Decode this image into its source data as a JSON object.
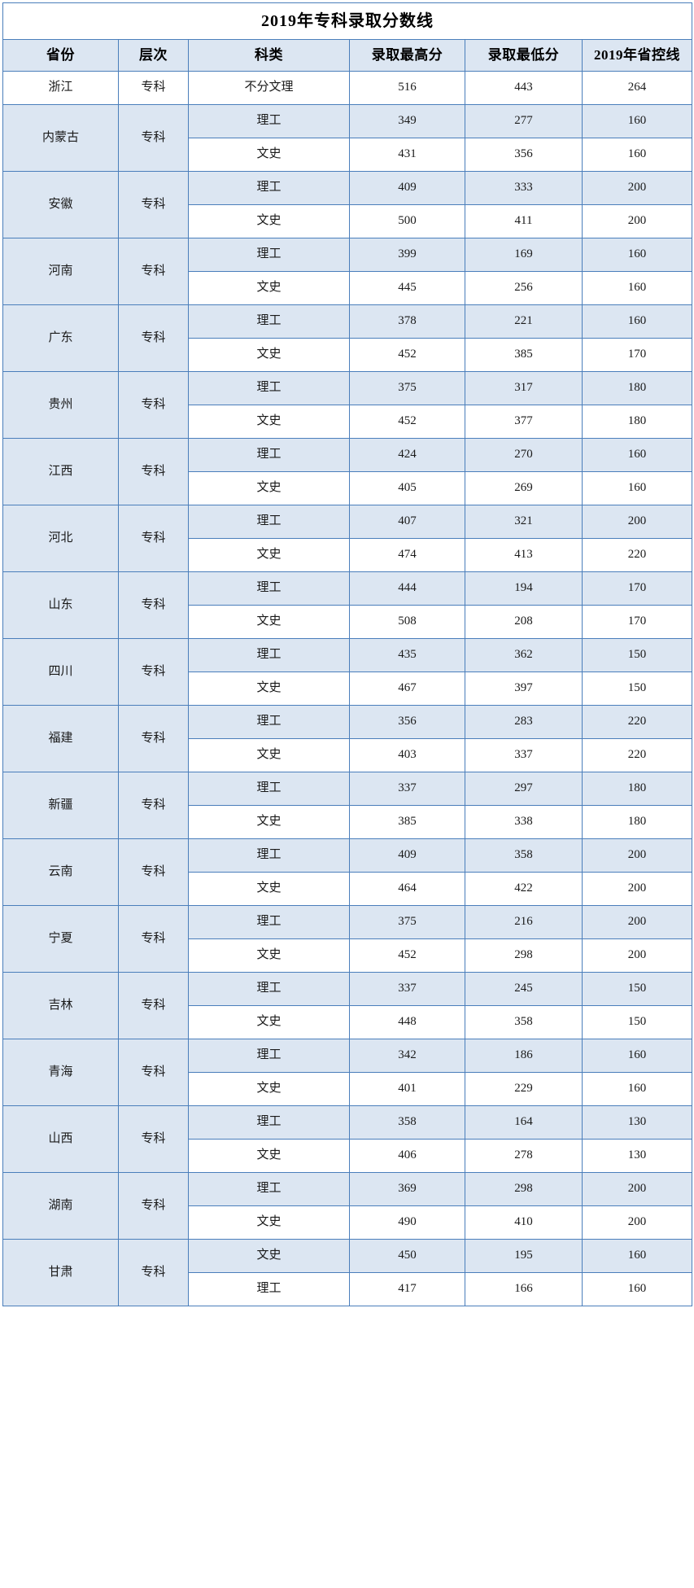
{
  "title": "2019年专科录取分数线",
  "colors": {
    "border": "#4a7ebb",
    "shade": "#dce6f2",
    "background": "#ffffff",
    "text": "#1a1a1a"
  },
  "columns": [
    {
      "key": "province",
      "label": "省份"
    },
    {
      "key": "level",
      "label": "层次"
    },
    {
      "key": "category",
      "label": "科类"
    },
    {
      "key": "highest",
      "label": "录取最高分"
    },
    {
      "key": "lowest",
      "label": "录取最低分"
    },
    {
      "key": "control_line",
      "label": "2019年省控线"
    }
  ],
  "chart_data": {
    "type": "table",
    "title": "2019年专科录取分数线",
    "columns": [
      "省份",
      "层次",
      "科类",
      "录取最高分",
      "录取最低分",
      "2019年省控线"
    ],
    "rows": [
      [
        "浙江",
        "专科",
        "不分文理",
        516,
        443,
        264
      ],
      [
        "内蒙古",
        "专科",
        "理工",
        349,
        277,
        160
      ],
      [
        "内蒙古",
        "专科",
        "文史",
        431,
        356,
        160
      ],
      [
        "安徽",
        "专科",
        "理工",
        409,
        333,
        200
      ],
      [
        "安徽",
        "专科",
        "文史",
        500,
        411,
        200
      ],
      [
        "河南",
        "专科",
        "理工",
        399,
        169,
        160
      ],
      [
        "河南",
        "专科",
        "文史",
        445,
        256,
        160
      ],
      [
        "广东",
        "专科",
        "理工",
        378,
        221,
        160
      ],
      [
        "广东",
        "专科",
        "文史",
        452,
        385,
        170
      ],
      [
        "贵州",
        "专科",
        "理工",
        375,
        317,
        180
      ],
      [
        "贵州",
        "专科",
        "文史",
        452,
        377,
        180
      ],
      [
        "江西",
        "专科",
        "理工",
        424,
        270,
        160
      ],
      [
        "江西",
        "专科",
        "文史",
        405,
        269,
        160
      ],
      [
        "河北",
        "专科",
        "理工",
        407,
        321,
        200
      ],
      [
        "河北",
        "专科",
        "文史",
        474,
        413,
        220
      ],
      [
        "山东",
        "专科",
        "理工",
        444,
        194,
        170
      ],
      [
        "山东",
        "专科",
        "文史",
        508,
        208,
        170
      ],
      [
        "四川",
        "专科",
        "理工",
        435,
        362,
        150
      ],
      [
        "四川",
        "专科",
        "文史",
        467,
        397,
        150
      ],
      [
        "福建",
        "专科",
        "理工",
        356,
        283,
        220
      ],
      [
        "福建",
        "专科",
        "文史",
        403,
        337,
        220
      ],
      [
        "新疆",
        "专科",
        "理工",
        337,
        297,
        180
      ],
      [
        "新疆",
        "专科",
        "文史",
        385,
        338,
        180
      ],
      [
        "云南",
        "专科",
        "理工",
        409,
        358,
        200
      ],
      [
        "云南",
        "专科",
        "文史",
        464,
        422,
        200
      ],
      [
        "宁夏",
        "专科",
        "理工",
        375,
        216,
        200
      ],
      [
        "宁夏",
        "专科",
        "文史",
        452,
        298,
        200
      ],
      [
        "吉林",
        "专科",
        "理工",
        337,
        245,
        150
      ],
      [
        "吉林",
        "专科",
        "文史",
        448,
        358,
        150
      ],
      [
        "青海",
        "专科",
        "理工",
        342,
        186,
        160
      ],
      [
        "青海",
        "专科",
        "文史",
        401,
        229,
        160
      ],
      [
        "山西",
        "专科",
        "理工",
        358,
        164,
        130
      ],
      [
        "山西",
        "专科",
        "文史",
        406,
        278,
        130
      ],
      [
        "湖南",
        "专科",
        "理工",
        369,
        298,
        200
      ],
      [
        "湖南",
        "专科",
        "文史",
        490,
        410,
        200
      ],
      [
        "甘肃",
        "专科",
        "文史",
        450,
        195,
        160
      ],
      [
        "甘肃",
        "专科",
        "理工",
        417,
        166,
        160
      ]
    ]
  },
  "groups": [
    {
      "province": "浙江",
      "level": "专科",
      "shaded": false,
      "entries": [
        {
          "category": "不分文理",
          "highest": "516",
          "lowest": "443",
          "control_line": "264",
          "shaded": false
        }
      ]
    },
    {
      "province": "内蒙古",
      "level": "专科",
      "shaded": true,
      "entries": [
        {
          "category": "理工",
          "highest": "349",
          "lowest": "277",
          "control_line": "160",
          "shaded": true
        },
        {
          "category": "文史",
          "highest": "431",
          "lowest": "356",
          "control_line": "160",
          "shaded": false
        }
      ]
    },
    {
      "province": "安徽",
      "level": "专科",
      "shaded": true,
      "entries": [
        {
          "category": "理工",
          "highest": "409",
          "lowest": "333",
          "control_line": "200",
          "shaded": true
        },
        {
          "category": "文史",
          "highest": "500",
          "lowest": "411",
          "control_line": "200",
          "shaded": false
        }
      ]
    },
    {
      "province": "河南",
      "level": "专科",
      "shaded": true,
      "entries": [
        {
          "category": "理工",
          "highest": "399",
          "lowest": "169",
          "control_line": "160",
          "shaded": true
        },
        {
          "category": "文史",
          "highest": "445",
          "lowest": "256",
          "control_line": "160",
          "shaded": false
        }
      ]
    },
    {
      "province": "广东",
      "level": "专科",
      "shaded": true,
      "entries": [
        {
          "category": "理工",
          "highest": "378",
          "lowest": "221",
          "control_line": "160",
          "shaded": true
        },
        {
          "category": "文史",
          "highest": "452",
          "lowest": "385",
          "control_line": "170",
          "shaded": false
        }
      ]
    },
    {
      "province": "贵州",
      "level": "专科",
      "shaded": true,
      "entries": [
        {
          "category": "理工",
          "highest": "375",
          "lowest": "317",
          "control_line": "180",
          "shaded": true
        },
        {
          "category": "文史",
          "highest": "452",
          "lowest": "377",
          "control_line": "180",
          "shaded": false
        }
      ]
    },
    {
      "province": "江西",
      "level": "专科",
      "shaded": true,
      "entries": [
        {
          "category": "理工",
          "highest": "424",
          "lowest": "270",
          "control_line": "160",
          "shaded": true
        },
        {
          "category": "文史",
          "highest": "405",
          "lowest": "269",
          "control_line": "160",
          "shaded": false
        }
      ]
    },
    {
      "province": "河北",
      "level": "专科",
      "shaded": true,
      "entries": [
        {
          "category": "理工",
          "highest": "407",
          "lowest": "321",
          "control_line": "200",
          "shaded": true
        },
        {
          "category": "文史",
          "highest": "474",
          "lowest": "413",
          "control_line": "220",
          "shaded": false
        }
      ]
    },
    {
      "province": "山东",
      "level": "专科",
      "shaded": true,
      "entries": [
        {
          "category": "理工",
          "highest": "444",
          "lowest": "194",
          "control_line": "170",
          "shaded": true
        },
        {
          "category": "文史",
          "highest": "508",
          "lowest": "208",
          "control_line": "170",
          "shaded": false
        }
      ]
    },
    {
      "province": "四川",
      "level": "专科",
      "shaded": true,
      "entries": [
        {
          "category": "理工",
          "highest": "435",
          "lowest": "362",
          "control_line": "150",
          "shaded": true
        },
        {
          "category": "文史",
          "highest": "467",
          "lowest": "397",
          "control_line": "150",
          "shaded": false
        }
      ]
    },
    {
      "province": "福建",
      "level": "专科",
      "shaded": true,
      "entries": [
        {
          "category": "理工",
          "highest": "356",
          "lowest": "283",
          "control_line": "220",
          "shaded": true
        },
        {
          "category": "文史",
          "highest": "403",
          "lowest": "337",
          "control_line": "220",
          "shaded": false
        }
      ]
    },
    {
      "province": "新疆",
      "level": "专科",
      "shaded": true,
      "entries": [
        {
          "category": "理工",
          "highest": "337",
          "lowest": "297",
          "control_line": "180",
          "shaded": true
        },
        {
          "category": "文史",
          "highest": "385",
          "lowest": "338",
          "control_line": "180",
          "shaded": false
        }
      ]
    },
    {
      "province": "云南",
      "level": "专科",
      "shaded": true,
      "entries": [
        {
          "category": "理工",
          "highest": "409",
          "lowest": "358",
          "control_line": "200",
          "shaded": true
        },
        {
          "category": "文史",
          "highest": "464",
          "lowest": "422",
          "control_line": "200",
          "shaded": false
        }
      ]
    },
    {
      "province": "宁夏",
      "level": "专科",
      "shaded": true,
      "entries": [
        {
          "category": "理工",
          "highest": "375",
          "lowest": "216",
          "control_line": "200",
          "shaded": true
        },
        {
          "category": "文史",
          "highest": "452",
          "lowest": "298",
          "control_line": "200",
          "shaded": false
        }
      ]
    },
    {
      "province": "吉林",
      "level": "专科",
      "shaded": true,
      "entries": [
        {
          "category": "理工",
          "highest": "337",
          "lowest": "245",
          "control_line": "150",
          "shaded": true
        },
        {
          "category": "文史",
          "highest": "448",
          "lowest": "358",
          "control_line": "150",
          "shaded": false
        }
      ]
    },
    {
      "province": "青海",
      "level": "专科",
      "shaded": true,
      "entries": [
        {
          "category": "理工",
          "highest": "342",
          "lowest": "186",
          "control_line": "160",
          "shaded": true
        },
        {
          "category": "文史",
          "highest": "401",
          "lowest": "229",
          "control_line": "160",
          "shaded": false
        }
      ]
    },
    {
      "province": "山西",
      "level": "专科",
      "shaded": true,
      "entries": [
        {
          "category": "理工",
          "highest": "358",
          "lowest": "164",
          "control_line": "130",
          "shaded": true
        },
        {
          "category": "文史",
          "highest": "406",
          "lowest": "278",
          "control_line": "130",
          "shaded": false
        }
      ]
    },
    {
      "province": "湖南",
      "level": "专科",
      "shaded": true,
      "entries": [
        {
          "category": "理工",
          "highest": "369",
          "lowest": "298",
          "control_line": "200",
          "shaded": true
        },
        {
          "category": "文史",
          "highest": "490",
          "lowest": "410",
          "control_line": "200",
          "shaded": false
        }
      ]
    },
    {
      "province": "甘肃",
      "level": "专科",
      "shaded": true,
      "entries": [
        {
          "category": "文史",
          "highest": "450",
          "lowest": "195",
          "control_line": "160",
          "shaded": true
        },
        {
          "category": "理工",
          "highest": "417",
          "lowest": "166",
          "control_line": "160",
          "shaded": false
        }
      ]
    }
  ]
}
